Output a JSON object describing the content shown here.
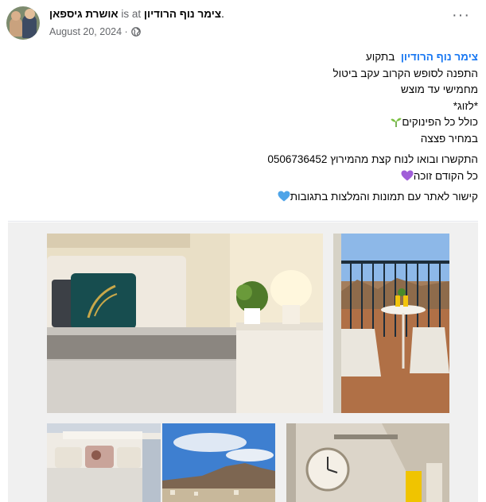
{
  "post": {
    "author": "אושרת גיספאן",
    "is_at": "is at",
    "place": "צימר נוף הרודיון",
    "trailing_dot": ".",
    "date": "August 20, 2024 ·",
    "more_label": "···"
  },
  "body": {
    "line1_link": "צימר נוף הרודיון",
    "line1_text": "בתקוע",
    "line2": "התפנה לסופש הקרוב עקב ביטול",
    "line3": "מחמישי עד מוצש",
    "line4": "*לזוג*",
    "line5": "כולל כל הפינוקים",
    "line6": "במחיר פצצה",
    "line7": "התקשרו ובואו לנוח קצת מהמירוץ 0506736452",
    "line8": "כל הקודם זוכה",
    "line9": "קישור לאתר עם תמונות והמלצות בתגובות"
  },
  "icons": {
    "globe": "globe-icon",
    "sprout": "seedling-icon",
    "purple_heart": "purple-heart-icon",
    "blue_heart": "blue-heart-icon",
    "more": "more-options-icon"
  },
  "colors": {
    "link_blue": "#1877f2",
    "secondary_text": "#65676b",
    "purple_heart": "#a05ed8",
    "blue_heart": "#4ea4e8",
    "gallery_bg": "#f0f0f0"
  }
}
